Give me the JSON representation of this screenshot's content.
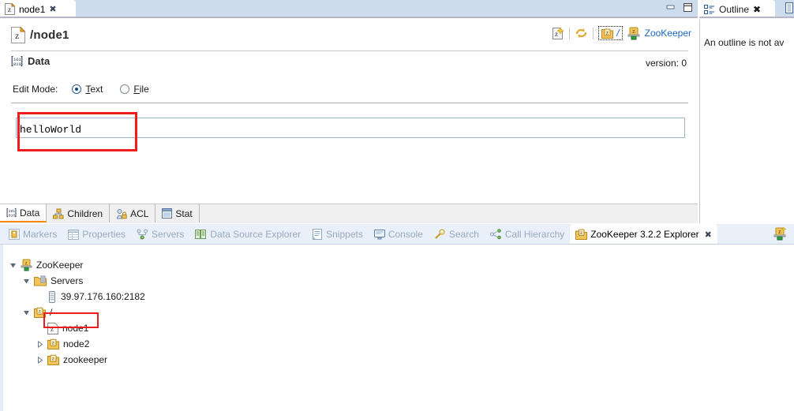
{
  "editor": {
    "tab": {
      "label": "node1",
      "icon": "znode-icon",
      "close": "✖"
    },
    "window_buttons": {
      "minimize": "minimize-icon",
      "maximize": "maximize-icon"
    },
    "header": {
      "title": "/node1",
      "icon": "znode-file-icon",
      "tools": [
        {
          "name": "new-znode-icon",
          "label": "z"
        },
        {
          "name": "refresh-icon",
          "label": ""
        },
        {
          "name": "znode-breadcrumb-icon",
          "label": "z"
        },
        {
          "name": "root-path-link",
          "label": "/"
        },
        {
          "name": "zookeeper-server-icon",
          "label": ""
        }
      ],
      "connection_link": "ZooKeeper"
    },
    "section": {
      "title": "Data",
      "icon": "binary-data-icon",
      "version_text": "version: 0"
    },
    "edit_mode": {
      "label": "Edit Mode:",
      "options": [
        {
          "label": "Text",
          "mnemonic": "T",
          "rest": "ext",
          "selected": true
        },
        {
          "label": "File",
          "mnemonic": "F",
          "rest": "ile",
          "selected": false
        }
      ]
    },
    "data_value": "helloWorld",
    "data_placeholder": "",
    "subtabs": [
      {
        "label": "Data",
        "icon": "binary-data-icon",
        "selected": true
      },
      {
        "label": "Children",
        "icon": "children-tree-icon",
        "selected": false
      },
      {
        "label": "ACL",
        "icon": "acl-lock-icon",
        "selected": false
      },
      {
        "label": "Stat",
        "icon": "stat-table-icon",
        "selected": false
      }
    ]
  },
  "outline": {
    "tab_label": "Outline",
    "tab_icon": "outline-icon",
    "close": "✖",
    "toolbar_icon": "view-menu-icon",
    "message": "An outline is not av"
  },
  "bottom_view": {
    "tabs": [
      {
        "label": "Markers",
        "icon": "markers-icon",
        "active": false,
        "closable": false
      },
      {
        "label": "Properties",
        "icon": "properties-icon",
        "active": false,
        "closable": false
      },
      {
        "label": "Servers",
        "icon": "servers-icon",
        "active": false,
        "closable": false
      },
      {
        "label": "Data Source Explorer",
        "icon": "data-source-explorer-icon",
        "active": false,
        "closable": false
      },
      {
        "label": "Snippets",
        "icon": "snippets-icon",
        "active": false,
        "closable": false
      },
      {
        "label": "Console",
        "icon": "console-icon",
        "active": false,
        "closable": false
      },
      {
        "label": "Search",
        "icon": "search-icon",
        "active": false,
        "closable": false
      },
      {
        "label": "Call Hierarchy",
        "icon": "call-hierarchy-icon",
        "active": false,
        "closable": false
      },
      {
        "label": "ZooKeeper 3.2.2 Explorer",
        "icon": "zookeeper-explorer-icon",
        "active": true,
        "closable": true,
        "close": "✖"
      }
    ],
    "toolbar_icon": "add-zookeeper-connection-icon",
    "tree": [
      {
        "label": "ZooKeeper",
        "icon": "zookeeper-root-icon",
        "indent": 0,
        "twisty": "expanded",
        "selected": false
      },
      {
        "label": "Servers",
        "icon": "servers-folder-icon",
        "indent": 1,
        "twisty": "expanded",
        "selected": false
      },
      {
        "label": "39.97.176.160:2182",
        "icon": "server-icon",
        "indent": 2,
        "twisty": "none",
        "selected": false
      },
      {
        "label": "/",
        "icon": "znode-icon",
        "indent": 1,
        "twisty": "expanded",
        "selected": false
      },
      {
        "label": "node1",
        "icon": "znode-icon",
        "indent": 2,
        "twisty": "none",
        "selected": true
      },
      {
        "label": "node2",
        "icon": "znode-icon",
        "indent": 2,
        "twisty": "collapsed",
        "selected": false
      },
      {
        "label": "zookeeper",
        "icon": "znode-icon",
        "indent": 2,
        "twisty": "collapsed",
        "selected": false
      }
    ]
  },
  "annotations": {
    "highlight_color": "#ee1d1d",
    "boxes": [
      "data-field-highlight",
      "node1-highlight"
    ]
  },
  "colors": {
    "tab_bar": "#ccdcec",
    "bottom_tab_bar": "#e9f0f9",
    "link": "#1a66c2",
    "selected_tab_underline": "#ff8a00"
  }
}
